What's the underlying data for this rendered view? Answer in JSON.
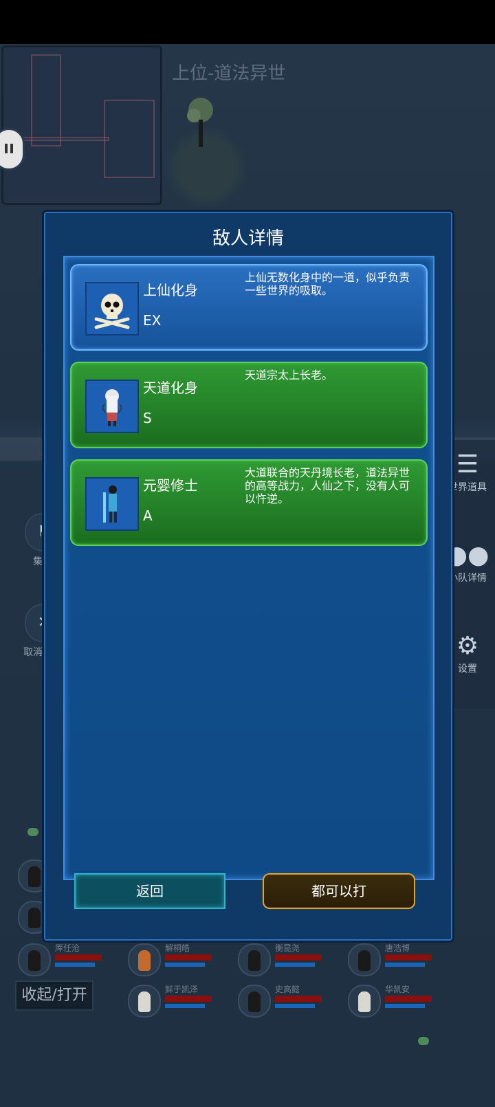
{
  "map": {
    "title": "上位-道法异世"
  },
  "side_menu": [
    {
      "label": "世界道具",
      "icon": "layers-icon"
    },
    {
      "label": "小队详情",
      "icon": "users-icon"
    },
    {
      "label": "设置",
      "icon": "gear-icon"
    }
  ],
  "left_buttons": [
    {
      "label": "集",
      "icon": "flag-icon"
    },
    {
      "label": "取消",
      "icon": "close-icon"
    }
  ],
  "party": [
    {
      "name": "厍任沧"
    },
    {
      "name": "解桐皓"
    },
    {
      "name": "衡昆尧"
    },
    {
      "name": "唐浩博"
    },
    {
      "name": "鲜于凯泽"
    },
    {
      "name": "史高懿"
    },
    {
      "name": "华凯安"
    }
  ],
  "collapse_label": "收起/打开",
  "dialog": {
    "title": "敌人详情",
    "enemies": [
      {
        "name": "上仙化身",
        "rank": "EX",
        "desc": "上仙无数化身中的一道，似乎负责一些世界的吸取。",
        "style": "blue",
        "portrait": "skull-icon"
      },
      {
        "name": "天道化身",
        "rank": "S",
        "desc": "天道宗太上长老。",
        "style": "green",
        "portrait": "white-hair-girl-portrait"
      },
      {
        "name": "元婴修士",
        "rank": "A",
        "desc": "大道联合的天丹境长老，道法异世的高等战力，人仙之下，没有人可以忤逆。",
        "style": "green",
        "portrait": "blue-robe-cultivator-portrait"
      }
    ],
    "back_label": "返回",
    "fight_label": "都可以打"
  },
  "colors": {
    "dialog_bg": "#0f3a68",
    "card_blue": "#2a6fc0",
    "card_green": "#2f9a33",
    "fight_border": "#e7a627",
    "back_border": "#2fb5c9"
  }
}
